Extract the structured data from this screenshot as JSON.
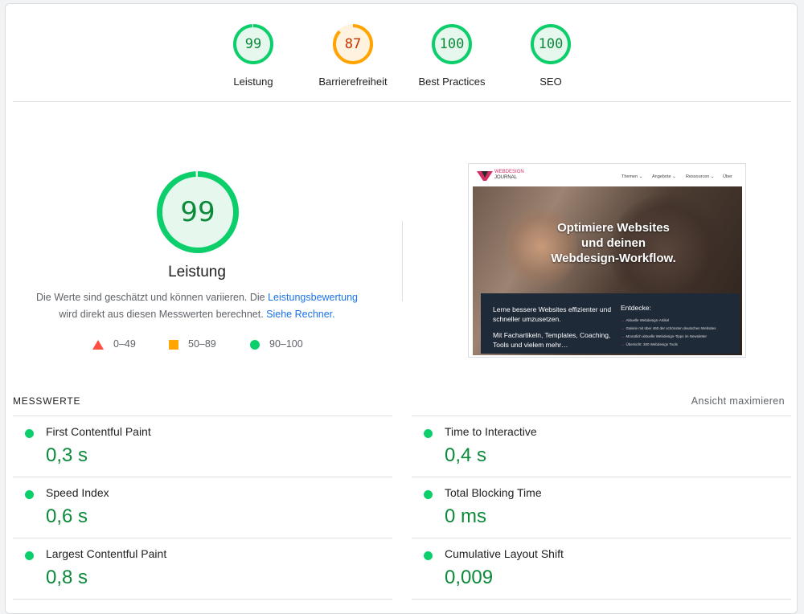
{
  "categories": [
    {
      "score": "99",
      "label": "Leistung",
      "fraction": 0.99,
      "color": "#0cce6b",
      "text_color": "#0b8a3a",
      "fill": "#e6f8ee"
    },
    {
      "score": "87",
      "label": "Barrierefreiheit",
      "fraction": 0.87,
      "color": "#ffa400",
      "text_color": "#c33300",
      "fill": "#fff3e0"
    },
    {
      "score": "100",
      "label": "Best Practices",
      "fraction": 1.0,
      "color": "#0cce6b",
      "text_color": "#0b8a3a",
      "fill": "#e6f8ee"
    },
    {
      "score": "100",
      "label": "SEO",
      "fraction": 1.0,
      "color": "#0cce6b",
      "text_color": "#0b8a3a",
      "fill": "#e6f8ee"
    }
  ],
  "performance": {
    "score": "99",
    "fraction": 0.99,
    "title": "Leistung",
    "desc_part1": "Die Werte sind geschätzt und können variieren. Die ",
    "link1": "Leistungsbewertung",
    "desc_part2": " wird direkt aus diesen Messwerten berechnet. ",
    "link2": "Siehe Rechner."
  },
  "legend": {
    "bad": "0–49",
    "average": "50–89",
    "good": "90–100",
    "colors": {
      "bad": "#ff4e42",
      "average": "#ffa400",
      "good": "#0cce6b"
    }
  },
  "screenshot": {
    "logo_line1": "WEBDESIGN",
    "logo_line2": "JOURNAL",
    "menu": [
      "Themen ⌄",
      "Angebote ⌄",
      "Ressourcen ⌄",
      "Über"
    ],
    "headline_1": "Optimiere Websites",
    "headline_2": "und deinen",
    "headline_3": "Webdesign-Workflow.",
    "panel_p1": "Lerne bessere Websites effizienter und schneller umzusetzen.",
    "panel_p2": "Mit Fachartikeln, Templates, Coaching, Tools und vielem mehr…",
    "panel_heading": "Entdecke:",
    "panel_items": [
      "Aktuelle Webdesign-Artikel",
      "Galerie mit über 460 der schönsten deutschen Websites",
      "Monatlich aktuelle Webdesign-Tipps im Newsletter",
      "Übersicht: 300 Webdesign Tools"
    ]
  },
  "metrics": {
    "heading": "MESSWERTE",
    "expand_label": "Ansicht maximieren",
    "items": [
      {
        "name": "First Contentful Paint",
        "value": "0,3 s"
      },
      {
        "name": "Time to Interactive",
        "value": "0,4 s"
      },
      {
        "name": "Speed Index",
        "value": "0,6 s"
      },
      {
        "name": "Total Blocking Time",
        "value": "0 ms"
      },
      {
        "name": "Largest Contentful Paint",
        "value": "0,8 s"
      },
      {
        "name": "Cumulative Layout Shift",
        "value": "0,009"
      }
    ]
  }
}
